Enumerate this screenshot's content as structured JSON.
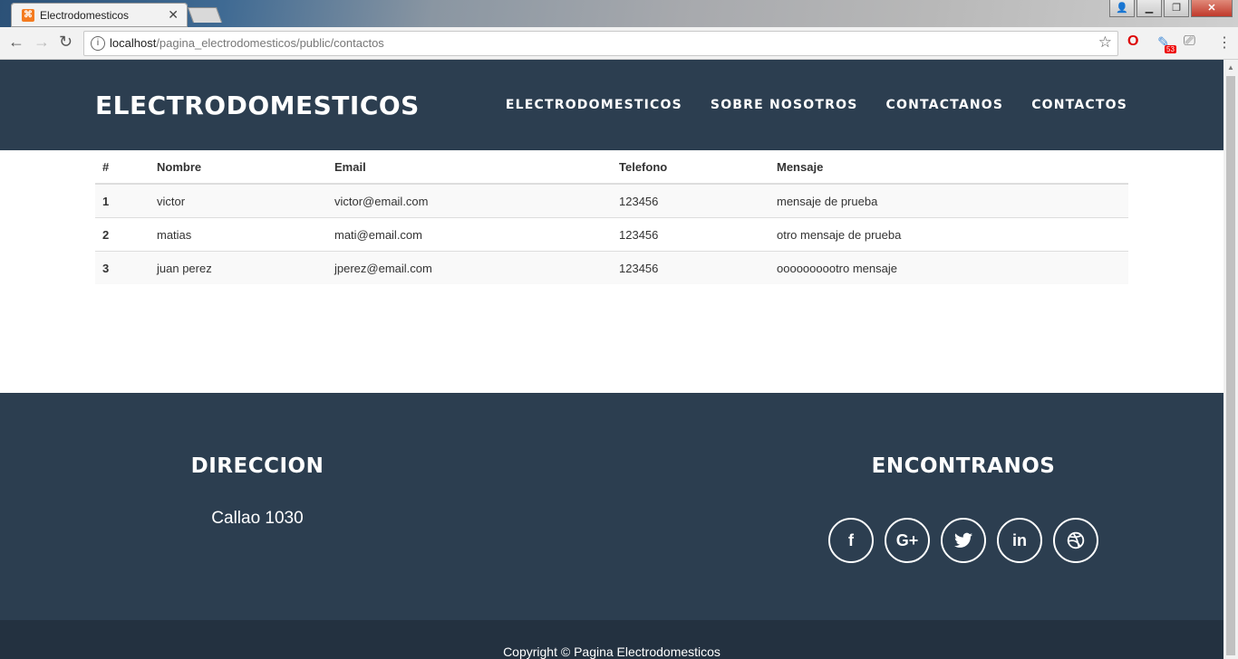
{
  "browser": {
    "tab_title": "Electrodomesticos",
    "url_host": "localhost",
    "url_path": "/pagina_electrodomesticos/public/contactos",
    "ext_badge": "53"
  },
  "header": {
    "brand": "ELECTRODOMESTICOS",
    "nav": [
      "ELECTRODOMESTICOS",
      "SOBRE NOSOTROS",
      "CONTACTANOS",
      "CONTACTOS"
    ]
  },
  "table": {
    "columns": [
      "#",
      "Nombre",
      "Email",
      "Telefono",
      "Mensaje"
    ],
    "rows": [
      [
        "1",
        "victor",
        "victor@email.com",
        "123456",
        "mensaje de prueba"
      ],
      [
        "2",
        "matias",
        "mati@email.com",
        "123456",
        "otro mensaje de prueba"
      ],
      [
        "3",
        "juan perez",
        "jperez@email.com",
        "123456",
        "oooooooootro mensaje"
      ]
    ]
  },
  "footer": {
    "direccion_title": "DIRECCION",
    "address": "Callao 1030",
    "encontranos_title": "ENCONTRANOS",
    "socials": [
      {
        "name": "facebook-icon",
        "glyph": "f"
      },
      {
        "name": "google-plus-icon",
        "glyph": "G+"
      },
      {
        "name": "twitter-icon",
        "glyph": "🐦"
      },
      {
        "name": "linkedin-icon",
        "glyph": "in"
      },
      {
        "name": "dribbble-icon",
        "glyph": "◎"
      }
    ],
    "copyright": "Copyright © Pagina Electrodomesticos"
  }
}
